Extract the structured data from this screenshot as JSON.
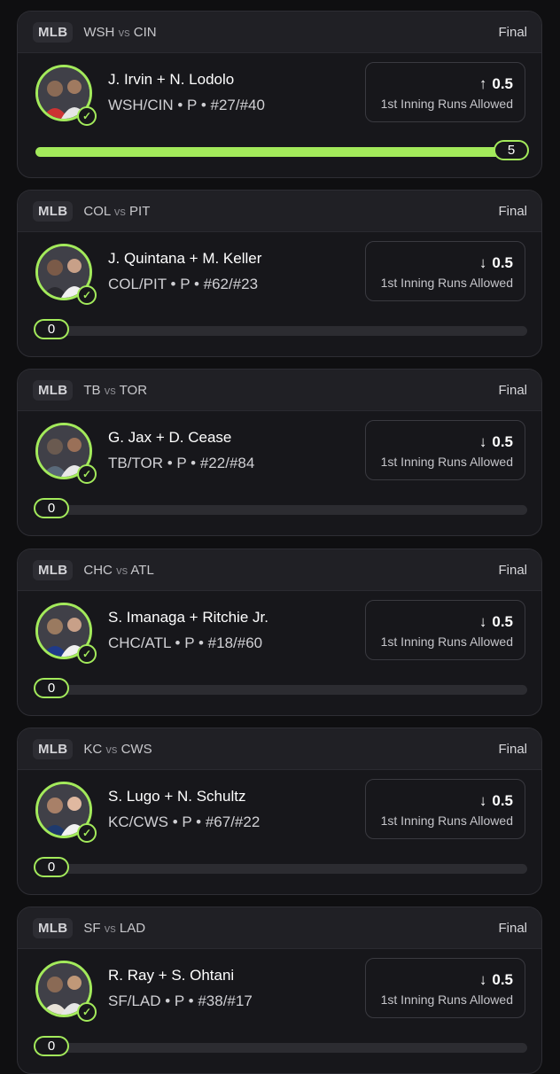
{
  "theme": {
    "accent": "#a3ea5b",
    "background": "#0f0f11",
    "card": "#17171b"
  },
  "cards": [
    {
      "league": "MLB",
      "team1": "WSH",
      "vs": "vs",
      "team2": "CIN",
      "status": "Final",
      "players": "J. Irvin + N. Lodolo",
      "meta": "WSH/CIN • P • #27/#40",
      "direction": "up",
      "arrow": "↑",
      "line": "0.5",
      "market": "1st Inning Runs Allowed",
      "result": "5",
      "progress": 1.0
    },
    {
      "league": "MLB",
      "team1": "COL",
      "vs": "vs",
      "team2": "PIT",
      "status": "Final",
      "players": "J. Quintana + M. Keller",
      "meta": "COL/PIT • P • #62/#23",
      "direction": "down",
      "arrow": "↓",
      "line": "0.5",
      "market": "1st Inning Runs Allowed",
      "result": "0",
      "progress": 0
    },
    {
      "league": "MLB",
      "team1": "TB",
      "vs": "vs",
      "team2": "TOR",
      "status": "Final",
      "players": "G. Jax + D. Cease",
      "meta": "TB/TOR • P • #22/#84",
      "direction": "down",
      "arrow": "↓",
      "line": "0.5",
      "market": "1st Inning Runs Allowed",
      "result": "0",
      "progress": 0
    },
    {
      "league": "MLB",
      "team1": "CHC",
      "vs": "vs",
      "team2": "ATL",
      "status": "Final",
      "players": "S. Imanaga + Ritchie Jr.",
      "meta": "CHC/ATL • P • #18/#60",
      "direction": "down",
      "arrow": "↓",
      "line": "0.5",
      "market": "1st Inning Runs Allowed",
      "result": "0",
      "progress": 0
    },
    {
      "league": "MLB",
      "team1": "KC",
      "vs": "vs",
      "team2": "CWS",
      "status": "Final",
      "players": "S. Lugo + N. Schultz",
      "meta": "KC/CWS • P • #67/#22",
      "direction": "down",
      "arrow": "↓",
      "line": "0.5",
      "market": "1st Inning Runs Allowed",
      "result": "0",
      "progress": 0
    },
    {
      "league": "MLB",
      "team1": "SF",
      "vs": "vs",
      "team2": "LAD",
      "status": "Final",
      "players": "R. Ray + S. Ohtani",
      "meta": "SF/LAD • P • #38/#17",
      "direction": "down",
      "arrow": "↓",
      "line": "0.5",
      "market": "1st Inning Runs Allowed",
      "result": "0",
      "progress": 0
    }
  ]
}
